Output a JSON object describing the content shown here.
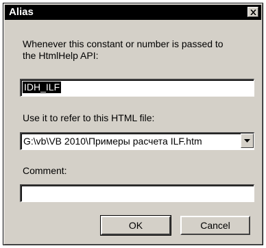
{
  "dialog": {
    "title": "Alias",
    "close_glyph": "✕"
  },
  "alias": {
    "label_line1": "Whenever this constant or number is passed to",
    "label_line2": "the HtmlHelp API:",
    "value": "IDH_ILF"
  },
  "file": {
    "label": "Use it to refer to this HTML file:",
    "value": "G:\\vb\\VB 2010\\Примеры расчета ILF.htm"
  },
  "comment": {
    "label": "Comment:",
    "value": ""
  },
  "buttons": {
    "ok": "OK",
    "cancel": "Cancel"
  }
}
